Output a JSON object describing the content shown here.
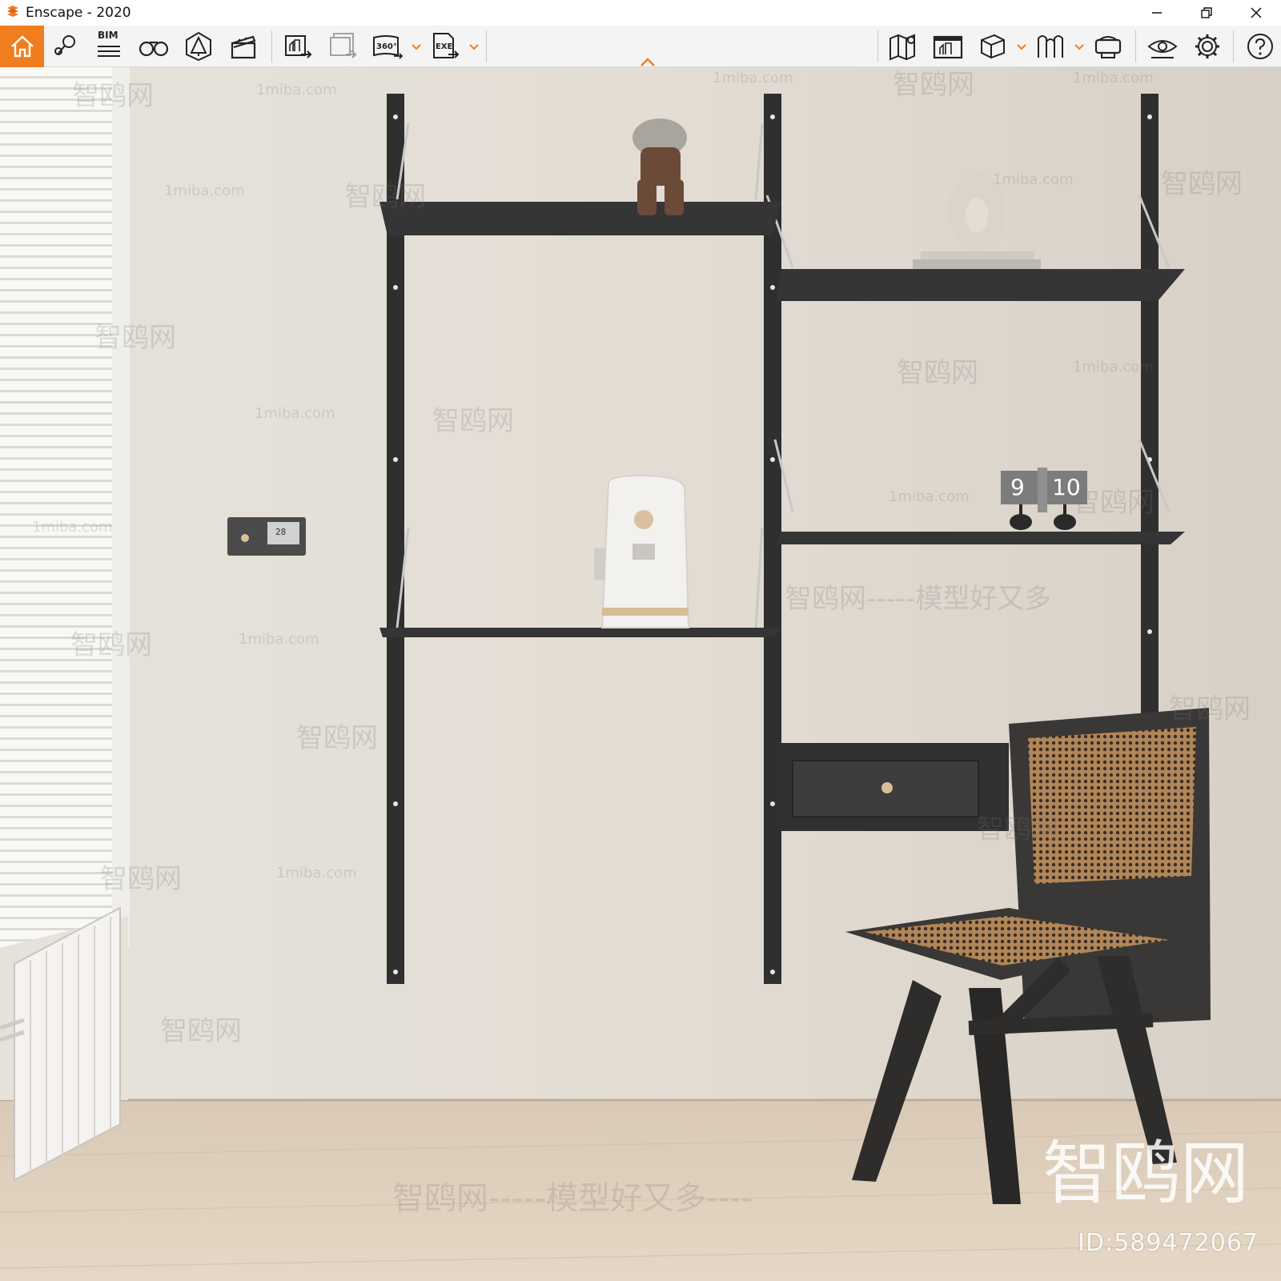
{
  "window": {
    "title": "Enscape - 2020",
    "brand_color": "#f07d1e"
  },
  "toolbar": {
    "left_tools": [
      {
        "name": "home",
        "icon": "home-icon"
      },
      {
        "name": "locations",
        "icon": "map-pin-icon"
      },
      {
        "name": "bim",
        "icon": "bim-list-icon",
        "label": "BIM"
      },
      {
        "name": "views",
        "icon": "binoculars-icon"
      },
      {
        "name": "assets",
        "icon": "asset-library-icon"
      },
      {
        "name": "video-editor",
        "icon": "clapperboard-icon"
      },
      {
        "name": "render-screenshot",
        "icon": "export-image-icon"
      },
      {
        "name": "batch-render",
        "icon": "batch-export-icon"
      },
      {
        "name": "panorama-360",
        "icon": "panorama-360-icon",
        "label": "360°"
      },
      {
        "name": "export-exe",
        "icon": "export-exe-icon",
        "label": "EXE"
      }
    ],
    "right_tools": [
      {
        "name": "map",
        "icon": "map-icon"
      },
      {
        "name": "screenshot-editor",
        "icon": "image-gallery-icon"
      },
      {
        "name": "cube-view",
        "icon": "cube-icon"
      },
      {
        "name": "sync",
        "icon": "sync-views-icon"
      },
      {
        "name": "vr-headset",
        "icon": "vr-headset-icon"
      },
      {
        "name": "visual-settings",
        "icon": "eye-icon"
      },
      {
        "name": "general-settings",
        "icon": "gear-icon"
      },
      {
        "name": "help",
        "icon": "help-icon"
      }
    ]
  },
  "viewport": {
    "watermarks": {
      "site": "1miba.com",
      "cn": "智鸥网",
      "cn_long": "智鸥网-----模型好又多----",
      "cn_short": "智鸥网-----模型好又多"
    },
    "logo_text": "智鸥网",
    "id_label": "ID:589472067",
    "thermostat_reading": "28",
    "clock_hour": "9",
    "clock_minute": "10"
  }
}
